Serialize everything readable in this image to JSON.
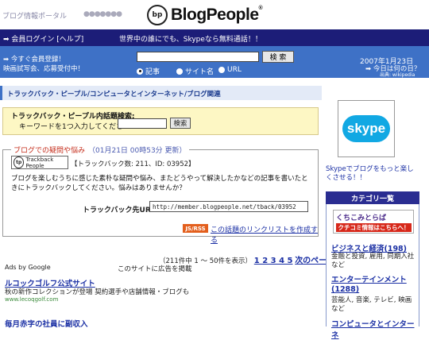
{
  "header": {
    "tagline": "ブログ情報ポータル",
    "dots": "●●●●●●●",
    "logo_mark": "bp",
    "logo_text": "BlogPeople",
    "logo_reg": "®"
  },
  "topbar": {
    "login": "➡ 会員ログイン [ヘルプ]",
    "ad": "世界中の誰にでも、Skypeなら無料通話！！"
  },
  "searchbar": {
    "register_line1": "➡ 今すぐ会員登録！",
    "register_line2": "映画試写会、応募受付中！",
    "search_button": "検 索",
    "radio": [
      "記事",
      "サイト名",
      "URL"
    ],
    "date": "2007年1月23日",
    "today": "➡ 今日は何の日？",
    "source": "出典: wikipedia"
  },
  "breadcrumb": "トラックバック・ピープル/コンピュータとインターネット/ブログ関連",
  "inbox": {
    "title": "トラックバック・ピープル内話題検索:",
    "prompt": "キーワードを1つ入力してください:",
    "button": "検索"
  },
  "topic": {
    "title": "ブログでの疑問や悩み",
    "updated": "（01月21日 00時53分 更新）",
    "badge": "Trackback People",
    "count": "【トラックバック数: 211、ID: 03952】",
    "body": "ブログを楽しむうちに感じた素朴な疑問や悩み、またどうやって解決したかなどの記事を書いたときにトラックバックしてください。悩みはありませんか？",
    "url_label": "トラックバック先URL:",
    "url": "http://member.blogpeople.net/tback/03952",
    "jsrss": "JS/RSS",
    "linklist": "この話題のリンクリストを作成する"
  },
  "pager": {
    "info": "（211件中  1 〜 50件を表示）",
    "pages": "1 2 3 4 5",
    "next": "次のページ"
  },
  "ads": {
    "label": "Ads by Google",
    "site_ad": "このサイトに広告を掲載",
    "ad1_title": "ルコックゴルフ公式サイト",
    "ad1_desc": "秋の新作コレクションが登場 契約選手や店舗情報・ブログも",
    "ad1_url": "www.lecoqgolf.com",
    "ad2_title": "毎月赤字の社員に副収入"
  },
  "sidebar": {
    "skype_logo": "skype",
    "skype_caption": "Skypeでブログをもっと楽しくさせる！！",
    "cat_header": "カテゴリ一覧",
    "kuchikomi_title": "くちこみとらば",
    "kuchikomi_sub": "クチコミ情報はこちらへ！",
    "categories": [
      {
        "title": "ビジネスと経済(198)",
        "desc": "金融と投資, 雇用, 同期入社など"
      },
      {
        "title": "エンターテインメント(1288)",
        "desc": "芸能人, 音楽, テレビ, 映画など"
      },
      {
        "title": "コンピュータとインターネ"
      }
    ]
  }
}
